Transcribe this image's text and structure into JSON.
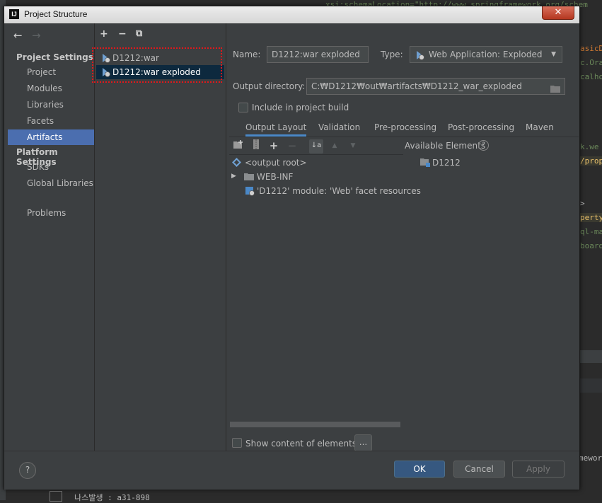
{
  "window": {
    "title": "Project Structure",
    "app_icon_text": "IJ",
    "close_glyph": "✕"
  },
  "sidebar": {
    "back_glyph": "←",
    "forward_glyph": "→",
    "project_settings_label": "Project Settings",
    "project_items": [
      "Project",
      "Modules",
      "Libraries",
      "Facets",
      "Artifacts"
    ],
    "platform_settings_label": "Platform Settings",
    "platform_items": [
      "SDKs",
      "Global Libraries"
    ],
    "problems_label": "Problems",
    "selected_item": "Artifacts"
  },
  "artifacts_panel": {
    "add_glyph": "+",
    "remove_glyph": "−",
    "copy_glyph": "⧉",
    "items": [
      "D1212:war",
      "D1212:war exploded"
    ],
    "selected_index": 1
  },
  "details": {
    "name_label": "Name:",
    "name_value": "D1212:war exploded",
    "type_label": "Type:",
    "type_value": "Web Application: Exploded",
    "output_dir_label": "Output directory:",
    "output_dir_value": "C:₩D1212₩out₩artifacts₩D1212_war_exploded",
    "include_label": "Include in project build",
    "include_checked": false
  },
  "tabs": [
    "Output Layout",
    "Validation",
    "Pre-processing",
    "Post-processing",
    "Maven"
  ],
  "active_tab": "Output Layout",
  "layout": {
    "available_elements_label": "Available Elements",
    "help_glyph": "?",
    "tree": {
      "output_root": "<output root>",
      "web_inf": "WEB-INF",
      "facet_resources": "'D1212' module: 'Web' facet resources"
    },
    "available": [
      "D1212"
    ]
  },
  "show_content_label": "Show content of elements",
  "show_content_checked": false,
  "ellipsis_label": "...",
  "buttons": {
    "ok": "OK",
    "cancel": "Cancel",
    "apply": "Apply",
    "help": "?"
  },
  "background_code": [
    "xsi:schemaLocation=\"http://www.springframework.org/schem",
    "asicD",
    "c.Ora",
    "calho",
    "k.we",
    "/prop",
    ">",
    "perty",
    "ql-ma",
    "board",
    "mewor",
    "나스발생 : a31-898"
  ],
  "colors": {
    "dialog_bg": "#3c3f41",
    "selection": "#4b6eaf",
    "ok_button": "#365880",
    "highlight_box": "#e0181b"
  }
}
